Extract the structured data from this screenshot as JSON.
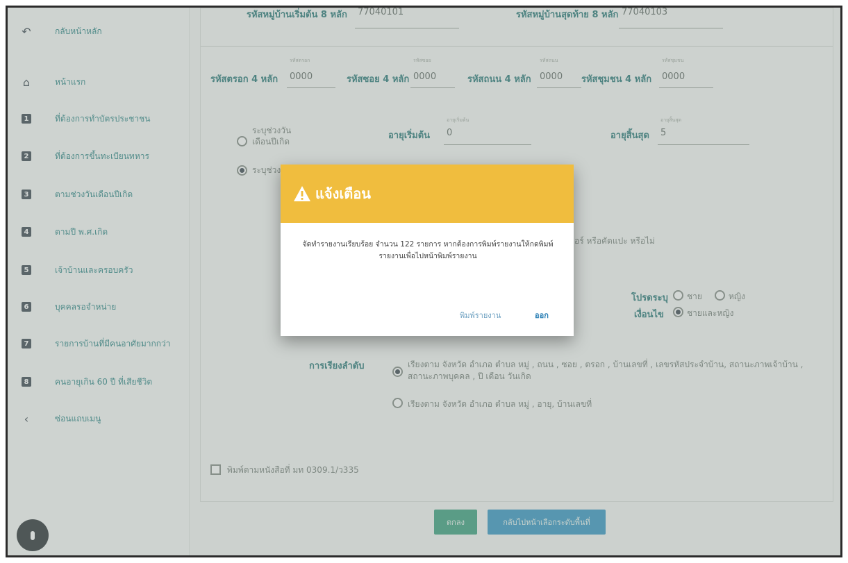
{
  "sidebar": {
    "items": [
      {
        "icon": "back-arrow-icon",
        "glyph": "↶",
        "label": "กลับหน้าหลัก"
      },
      {
        "icon": "home-icon",
        "glyph": "⌂",
        "label": "หน้าแรก"
      },
      {
        "icon": "number-1-icon",
        "glyph": "1",
        "label": "ที่ต้องการทำบัตรประชาชน"
      },
      {
        "icon": "number-2-icon",
        "glyph": "2",
        "label": "ที่ต้องการขึ้นทะเบียนทหาร"
      },
      {
        "icon": "number-3-icon",
        "glyph": "3",
        "label": "ตามช่วงวันเดือนปีเกิด"
      },
      {
        "icon": "number-4-icon",
        "glyph": "4",
        "label": "ตามปี พ.ศ.เกิด"
      },
      {
        "icon": "number-5-icon",
        "glyph": "5",
        "label": "เจ้าบ้านและครอบครัว"
      },
      {
        "icon": "number-6-icon",
        "glyph": "6",
        "label": "บุคคลรอจำหน่าย"
      },
      {
        "icon": "number-7-icon",
        "glyph": "7",
        "label": "รายการบ้านที่มีคนอาศัยมากกว่า"
      },
      {
        "icon": "number-8-icon",
        "glyph": "8",
        "label": "คนอายุเกิน 60 ปี ที่เสียชีวิต"
      },
      {
        "icon": "chevron-left-icon",
        "glyph": "‹",
        "label": "ซ่อนแถบเมนู"
      }
    ]
  },
  "form": {
    "village_start_label": "รหัสหมู่บ้านเริ่มต้น 8 หลัก",
    "village_start_value": "77040101",
    "village_end_label": "รหัสหมู่บ้านสุดท้าย 8 หลัก",
    "village_end_value": "77040103",
    "codes": [
      {
        "label": "รหัสตรอก 4 หลัก",
        "caption": "รหัสตรอก",
        "value": "0000"
      },
      {
        "label": "รหัสซอย 4 หลัก",
        "caption": "รหัสซอย",
        "value": "0000"
      },
      {
        "label": "รหัสถนน 4 หลัก",
        "caption": "รหัสถนน",
        "value": "0000"
      },
      {
        "label": "รหัสชุมชน 4 หลัก",
        "caption": "รหัสชุมชน",
        "value": "0000"
      }
    ],
    "range_option_1": "ระบุช่วงวัน\nเดือนปีเกิด",
    "range_option_2": "ระบุช่วง",
    "age_start_label": "อายุเริ่มต้น",
    "age_start_caption": "อายุเริ่มต้น",
    "age_start_value": "0",
    "age_end_label": "อายุสิ้นสุด",
    "age_end_caption": "อายุสิ้นสุด",
    "age_end_value": "5",
    "behind_text": "อร์ หรือคัดแปะ หรือไม่",
    "gender_label": "โปรดระบุ",
    "gender_male": "ชาย",
    "gender_female": "หญิง",
    "condition_label": "เงื่อนไข",
    "condition_both": "ชายและหญิง",
    "sort_label": "การเรียงลำดับ",
    "sort_option_1": "เรียงตาม จังหวัด อำเภอ ตำบล หมู่ , ถนน , ซอย , ตรอก , บ้านเลขที่ , เลขรหัสประจำบ้าน, สถานะภาพเจ้าบ้าน ,",
    "sort_option_1b": "สถานะภาพบุคคล , ปี เดือน วันเกิด",
    "sort_option_2": "เรียงตาม จังหวัด อำเภอ ตำบล หมู่ , อายุ, บ้านเลขที่",
    "checkbox_label": "พิมพ์ตามหนังสือที่ มท 0309.1/ว335"
  },
  "buttons": {
    "ok": "ตกลง",
    "back": "กลับไปหน้าเลือกระดับพื้นที่"
  },
  "modal": {
    "title": "แจ้งเตือน",
    "message": "จัดทำรายงานเรียบร้อย จำนวน 122 รายการ หากต้องการพิมพ์รายงานให้กดพิมพ์ รายงานเพื่อไปหน้าพิมพ์รายงาน",
    "print_button": "พิมพ์รายงาน",
    "exit_button": "ออก"
  },
  "colors": {
    "accent": "#1b6f6f",
    "modal_header": "#f0bd3e",
    "ok_button": "#2f9a78",
    "back_button": "#2a8fbf"
  }
}
